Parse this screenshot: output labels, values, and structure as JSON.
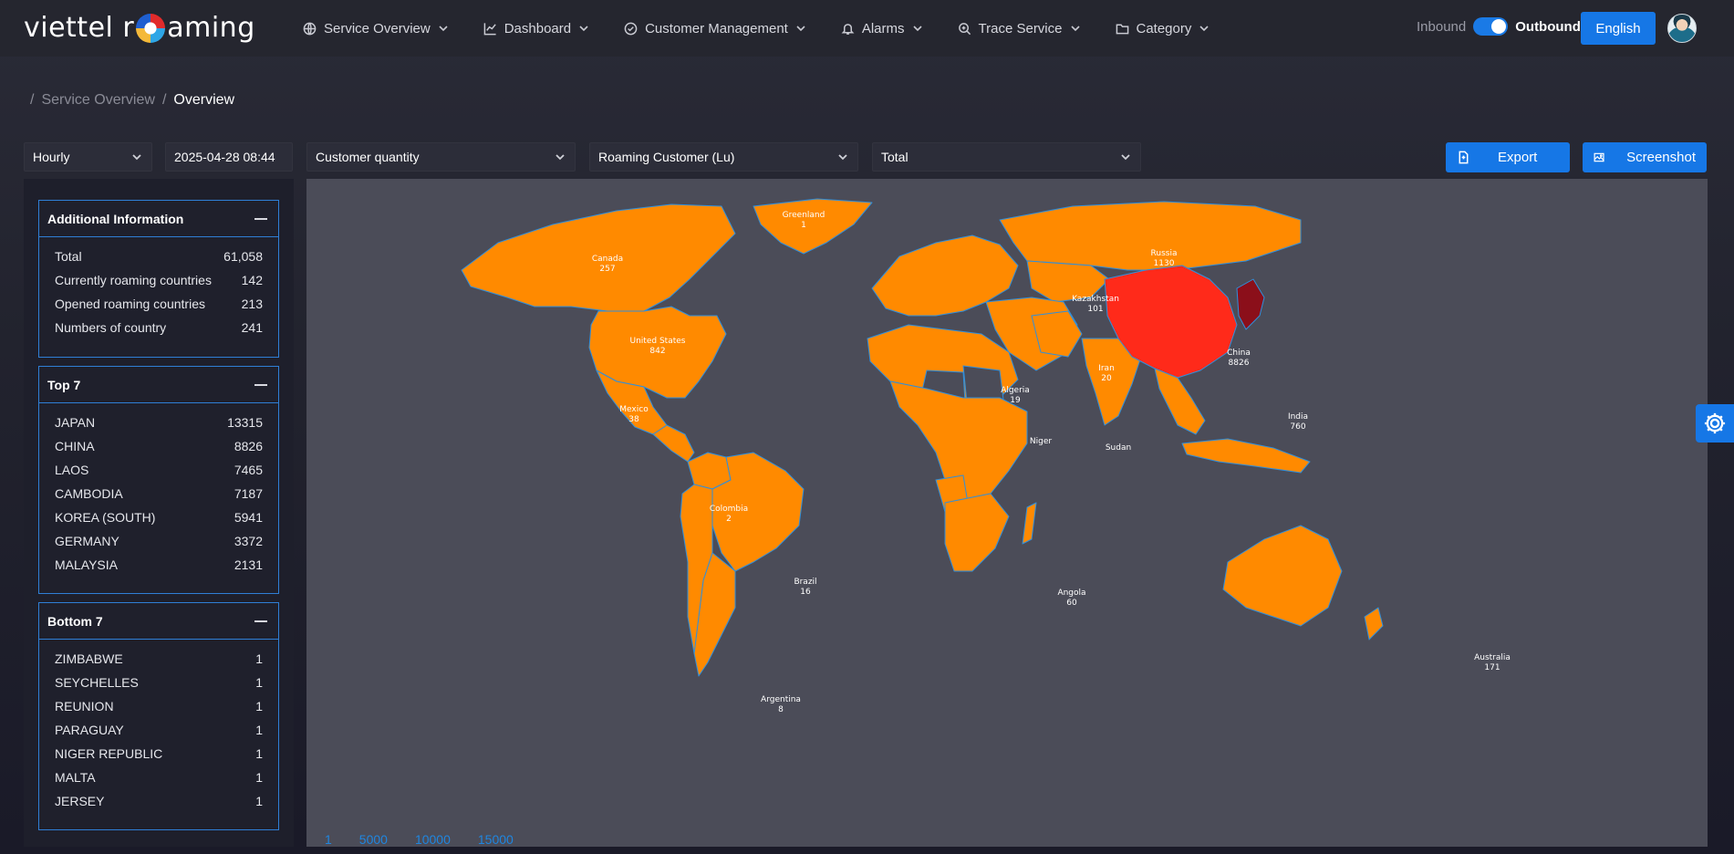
{
  "header": {
    "logo_left": "viettel r",
    "logo_right": "aming",
    "nav": [
      {
        "label": "Service Overview",
        "icon": "globe-icon"
      },
      {
        "label": "Dashboard",
        "icon": "chart-line-icon"
      },
      {
        "label": "Customer Management",
        "icon": "check-circle-icon"
      },
      {
        "label": "Alarms",
        "icon": "bell-icon"
      },
      {
        "label": "Trace Service",
        "icon": "search-icon"
      },
      {
        "label": "Category",
        "icon": "folder-icon"
      }
    ],
    "inbound_label": "Inbound",
    "outbound_label": "Outbound",
    "toggle_state": "outbound",
    "language": "English"
  },
  "breadcrumb": {
    "parent": "Service Overview",
    "current": "Overview"
  },
  "filters": {
    "interval": "Hourly",
    "datetime": "2025-04-28 08:44",
    "metric": "Customer quantity",
    "customer_type": "Roaming Customer (Lu)",
    "scope": "Total"
  },
  "actions": {
    "export": "Export",
    "screenshot": "Screenshot"
  },
  "additional_info": {
    "title": "Additional Information",
    "rows": [
      {
        "label": "Total",
        "value": "61,058"
      },
      {
        "label": "Currently roaming countries",
        "value": "142"
      },
      {
        "label": "Opened roaming countries",
        "value": "213"
      },
      {
        "label": "Numbers of country",
        "value": "241"
      }
    ]
  },
  "top7": {
    "title": "Top 7",
    "rows": [
      {
        "label": "JAPAN",
        "value": "13315"
      },
      {
        "label": "CHINA",
        "value": "8826"
      },
      {
        "label": "LAOS",
        "value": "7465"
      },
      {
        "label": "CAMBODIA",
        "value": "7187"
      },
      {
        "label": "KOREA (SOUTH)",
        "value": "5941"
      },
      {
        "label": "GERMANY",
        "value": "3372"
      },
      {
        "label": "MALAYSIA",
        "value": "2131"
      }
    ]
  },
  "bottom7": {
    "title": "Bottom 7",
    "rows": [
      {
        "label": "ZIMBABWE",
        "value": "1"
      },
      {
        "label": "SEYCHELLES",
        "value": "1"
      },
      {
        "label": "REUNION",
        "value": "1"
      },
      {
        "label": "PARAGUAY",
        "value": "1"
      },
      {
        "label": "NIGER REPUBLIC",
        "value": "1"
      },
      {
        "label": "MALTA",
        "value": "1"
      },
      {
        "label": "JERSEY",
        "value": "1"
      }
    ]
  },
  "map": {
    "colors": {
      "background": "#4b4c58",
      "land": "#ff8a00",
      "high": "#ff2a1a",
      "highest": "#8b0f1a",
      "nodata": "#4b4c58",
      "border": "#2f8fdc"
    },
    "countries": [
      {
        "name": "Greenland",
        "value": "1"
      },
      {
        "name": "Canada",
        "value": "257"
      },
      {
        "name": "Russia",
        "value": "1130"
      },
      {
        "name": "Kazakhstan",
        "value": "101"
      },
      {
        "name": "United States",
        "value": "842"
      },
      {
        "name": "China",
        "value": "8826"
      },
      {
        "name": "Iran",
        "value": "20"
      },
      {
        "name": "Mexico",
        "value": "38"
      },
      {
        "name": "Algeria",
        "value": "19"
      },
      {
        "name": "India",
        "value": "760"
      },
      {
        "name": "Niger",
        "value": ""
      },
      {
        "name": "Sudan",
        "value": ""
      },
      {
        "name": "Colombia",
        "value": "2"
      },
      {
        "name": "Brazil",
        "value": "16"
      },
      {
        "name": "Angola",
        "value": "60"
      },
      {
        "name": "Argentina",
        "value": "8"
      },
      {
        "name": "Australia",
        "value": "171"
      }
    ],
    "legend": [
      "1",
      "5000",
      "10000",
      "15000"
    ]
  },
  "settings_icon": "gear-icon"
}
